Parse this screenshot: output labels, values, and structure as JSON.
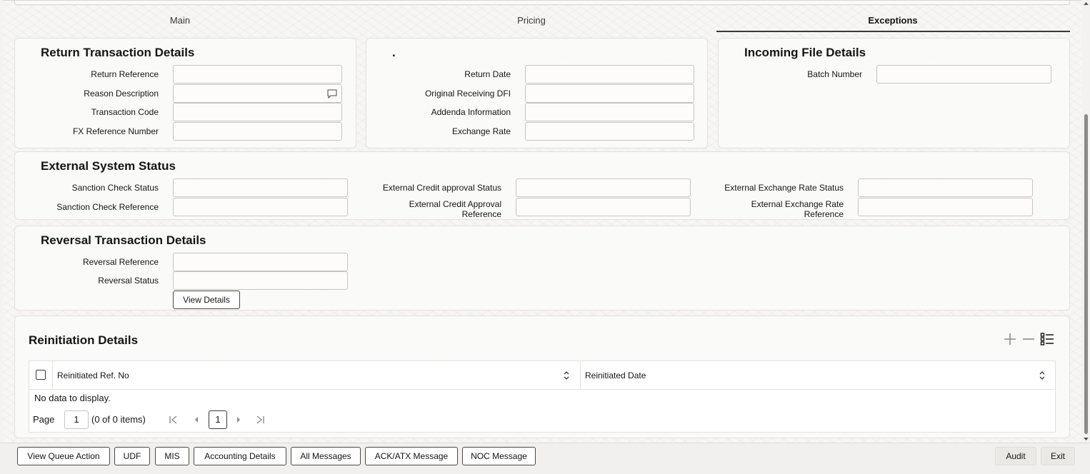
{
  "tabs": [
    {
      "label": "Main"
    },
    {
      "label": "Pricing"
    },
    {
      "label": "Exceptions",
      "active": true
    }
  ],
  "return_section": {
    "title": "Return Transaction Details",
    "fields": [
      {
        "label": "Return Reference",
        "value": ""
      },
      {
        "label": "Reason Description",
        "value": ""
      },
      {
        "label": "Transaction Code",
        "value": ""
      },
      {
        "label": "FX Reference Number",
        "value": ""
      }
    ]
  },
  "middle_section": {
    "title": ".",
    "fields": [
      {
        "label": "Return Date",
        "value": ""
      },
      {
        "label": "Original Receiving DFI",
        "value": ""
      },
      {
        "label": "Addenda Information",
        "value": ""
      },
      {
        "label": "Exchange Rate",
        "value": ""
      }
    ]
  },
  "incoming_section": {
    "title": "Incoming File Details",
    "fields": [
      {
        "label": "Batch Number",
        "value": ""
      }
    ]
  },
  "external_section": {
    "title": "External System Status",
    "fields": [
      {
        "label": "Sanction Check Status",
        "value": ""
      },
      {
        "label": "Sanction Check Reference",
        "value": ""
      },
      {
        "label": "External Credit approval Status",
        "value": ""
      },
      {
        "label": "External Credit Approval Reference",
        "value": ""
      },
      {
        "label": "External Exchange Rate Status",
        "value": ""
      },
      {
        "label": "External Exchange Rate Reference",
        "value": ""
      }
    ]
  },
  "reversal_section": {
    "title": "Reversal Transaction Details",
    "fields": [
      {
        "label": "Reversal Reference",
        "value": ""
      },
      {
        "label": "Reversal Status",
        "value": ""
      }
    ],
    "view_details_label": "View Details"
  },
  "reinitiation": {
    "title": "Reinitiation Details",
    "columns": [
      "Reinitiated Ref. No",
      "Reinitiated Date"
    ],
    "empty_text": "No data to display.",
    "pagination": {
      "page_label": "Page",
      "page_value": "1",
      "items_text": "(0 of 0 items)",
      "current_page": "1"
    },
    "toolbar_icons": [
      "add-icon",
      "remove-icon",
      "list-icon"
    ]
  },
  "footer": {
    "buttons": [
      "View Queue Action",
      "UDF",
      "MIS",
      "Accounting Details",
      "All Messages",
      "ACK/ATX Message",
      "NOC Message"
    ],
    "audit_label": "Audit",
    "exit_label": "Exit"
  }
}
